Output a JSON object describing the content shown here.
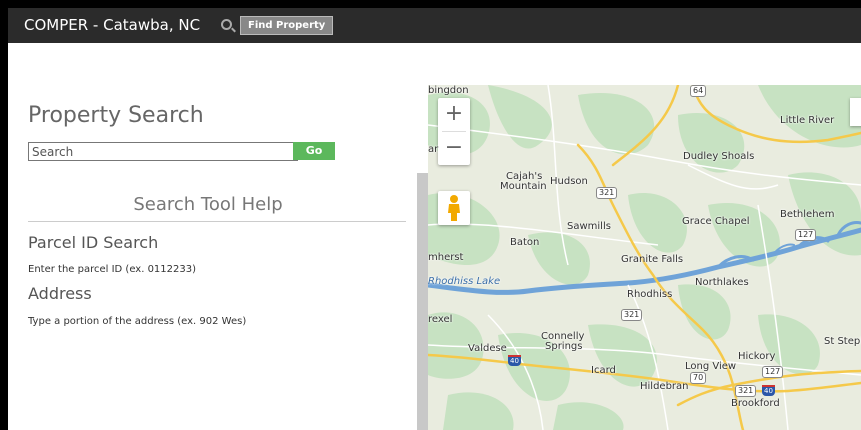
{
  "header": {
    "title": "COMPER - Catawba, NC",
    "find_property_label": "Find Property"
  },
  "search_panel": {
    "title": "Property Search",
    "search_placeholder": "Search",
    "go_label": "Go"
  },
  "help": {
    "title": "Search Tool Help",
    "sections": [
      {
        "heading": "Parcel ID Search",
        "text": "Enter the parcel ID (ex. 0112233)"
      },
      {
        "heading": "Address",
        "text": "Type a portion of the address (ex. 902 Wes)"
      }
    ]
  },
  "map": {
    "zoom_in": "+",
    "zoom_out": "−",
    "place_labels": [
      "bingdon",
      "Little River",
      "Dudley Shoals",
      "Cajah's",
      "Mountain",
      "Hudson",
      "Bethlehem",
      "Sawmills",
      "Grace Chapel",
      "Baton",
      "mherst",
      "Granite Falls",
      "Rhodhiss Lake",
      "Rhodhiss",
      "Northlakes",
      "rexel",
      "Connelly",
      "Springs",
      "Valdese",
      "St Steph",
      "Hickory",
      "Long View",
      "Icard",
      "Hildebran",
      "Brookford",
      "ar"
    ],
    "route_shields": [
      "64",
      "321",
      "127",
      "321",
      "127",
      "70",
      "321"
    ],
    "interstate_shields": [
      "40",
      "40"
    ],
    "colors": {
      "land": "#e9ecdf",
      "forest": "#c7e2c2",
      "water": "#6fa3d8",
      "highway": "#f5c94a",
      "road": "#ffffff"
    }
  }
}
